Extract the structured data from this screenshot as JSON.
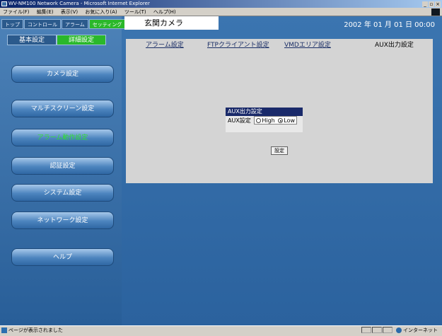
{
  "window": {
    "title": "WV-NM100 Network Camera - Microsoft Internet Explorer"
  },
  "menubar": {
    "items": [
      "ファイル(F)",
      "編集(E)",
      "表示(V)",
      "お気に入り(A)",
      "ツール(T)",
      "ヘルプ(H)"
    ]
  },
  "topnav": {
    "items": [
      "トップ",
      "コントロール",
      "アラーム",
      "セッティング"
    ],
    "active_index": 3
  },
  "camera_name": "玄関カメラ",
  "datetime": "2002 年 01 月 01 日  00:00",
  "subtabs": {
    "items": [
      "基本設定",
      "詳細設定"
    ],
    "active_index": 1
  },
  "left_nav": {
    "items": [
      "カメラ設定",
      "マルチスクリーン設定",
      "アラーム動作設定",
      "認証設定",
      "システム設定",
      "ネットワーク設定",
      "ヘルプ"
    ],
    "active_index": 2
  },
  "settings_tabs": {
    "items": [
      "アラーム設定",
      "FTPクライアント設定",
      "VMDエリア設定",
      "AUX出力設定"
    ],
    "active_index": 3
  },
  "aux_panel": {
    "header": "AUX出力設定",
    "label": "AUX設定",
    "options": [
      "High",
      "Low"
    ],
    "selected": "Low",
    "submit_label": "設定"
  },
  "statusbar": {
    "text": "ページが表示されました",
    "zone": "インターネット"
  }
}
